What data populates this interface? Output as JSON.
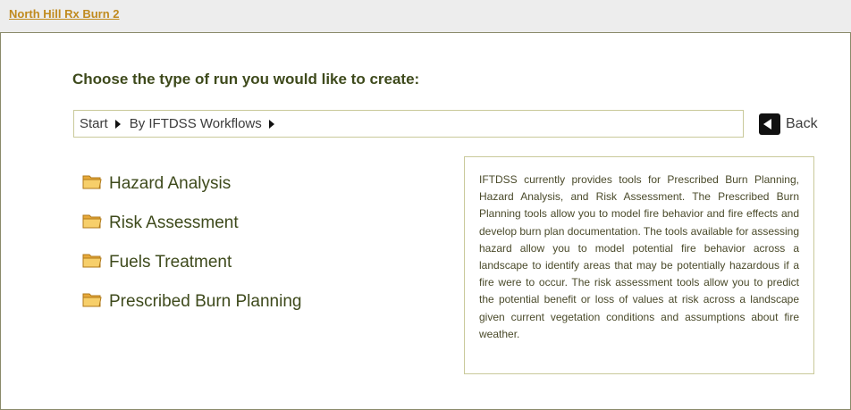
{
  "header": {
    "project_link": "North Hill Rx Burn 2"
  },
  "main": {
    "heading": "Choose the type of run you would like to create:",
    "breadcrumb": [
      "Start",
      "By IFTDSS Workflows"
    ],
    "back_label": "Back",
    "options": [
      {
        "label": "Hazard Analysis",
        "icon": "folder-icon"
      },
      {
        "label": "Risk Assessment",
        "icon": "folder-icon"
      },
      {
        "label": "Fuels Treatment",
        "icon": "folder-icon"
      },
      {
        "label": "Prescribed Burn Planning",
        "icon": "folder-icon"
      }
    ],
    "info_text": "IFTDSS currently provides tools for Prescribed Burn Planning, Hazard Analysis, and Risk Assessment. The Prescribed Burn Planning tools allow you to model fire behavior and fire effects and develop burn plan documentation. The tools available for assessing hazard allow you to model potential fire behavior across a landscape to identify areas that may be potentially hazardous if a fire were to occur. The risk assessment tools allow you to predict the potential benefit or loss of values at risk across a landscape given current vegetation conditions and assumptions about fire weather."
  },
  "colors": {
    "link": "#c08a1e",
    "heading": "#3e4a1c",
    "border": "#c9c99a",
    "folder": "#e8a93a"
  }
}
